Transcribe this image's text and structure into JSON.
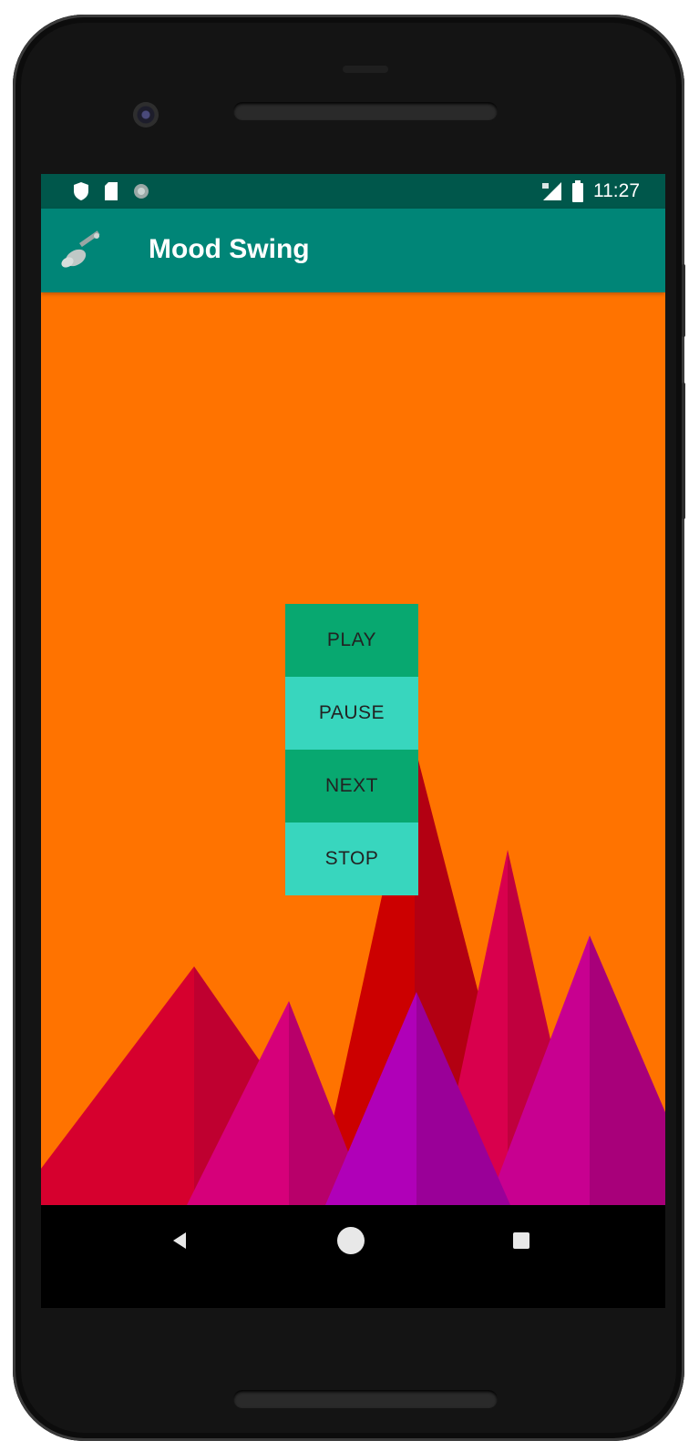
{
  "status_bar": {
    "time": "11:27",
    "left_icons": [
      "shield-icon",
      "sim-card-icon",
      "circle-icon"
    ],
    "right_icons": [
      "signal-icon",
      "battery-icon"
    ]
  },
  "app_bar": {
    "title": "Mood Swing",
    "logo_icon": "guitar-icon",
    "background_color": "#008577",
    "status_color": "#00574b"
  },
  "content": {
    "background_color": "#ff7300",
    "buttons": [
      {
        "label": "PLAY",
        "color": "#08a870"
      },
      {
        "label": "PAUSE",
        "color": "#38d6be"
      },
      {
        "label": "NEXT",
        "color": "#08a870"
      },
      {
        "label": "STOP",
        "color": "#38d6be"
      }
    ]
  },
  "nav_bar": {
    "icons": [
      "back-icon",
      "home-icon",
      "recents-icon"
    ]
  }
}
